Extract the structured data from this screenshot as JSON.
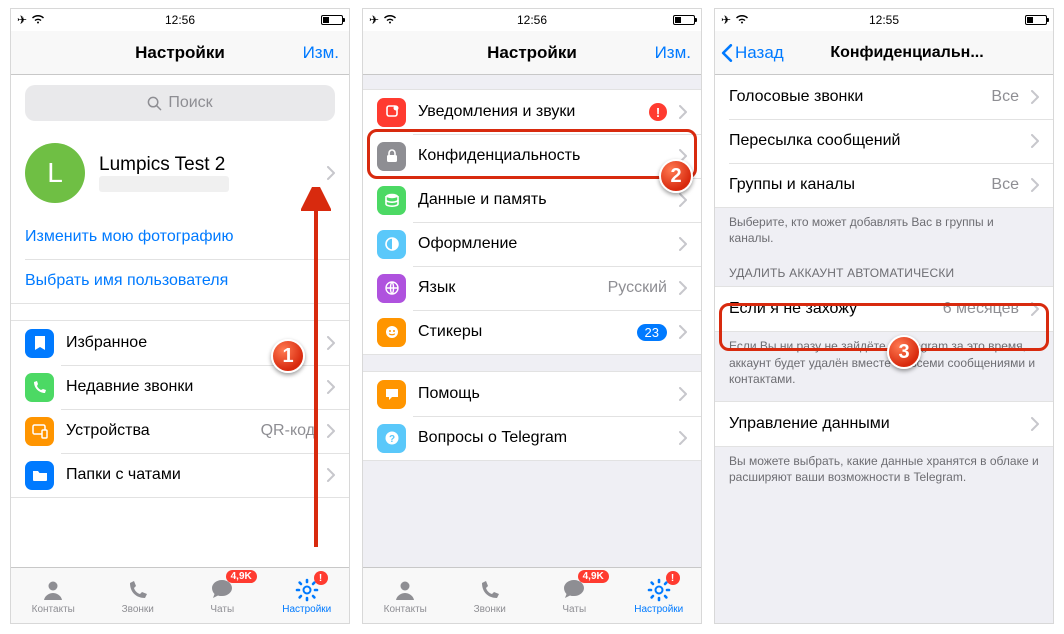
{
  "status": {
    "time1": "12:56",
    "time2": "12:56",
    "time3": "12:55"
  },
  "nav": {
    "settings_title": "Настройки",
    "edit": "Изм.",
    "back": "Назад",
    "privacy_title": "Конфиденциальн..."
  },
  "s1": {
    "search_placeholder": "Поиск",
    "profile_initial": "L",
    "profile_name": "Lumpics Test 2",
    "change_photo": "Изменить мою фотографию",
    "choose_username": "Выбрать имя пользователя",
    "favorites": "Избранное",
    "recent_calls": "Недавние звонки",
    "devices": "Устройства",
    "devices_value": "QR-код",
    "chat_folders": "Папки с чатами"
  },
  "s2": {
    "notifications": "Уведомления и звуки",
    "privacy": "Конфиденциальность",
    "data": "Данные и память",
    "appearance": "Оформление",
    "language": "Язык",
    "language_value": "Русский",
    "stickers": "Стикеры",
    "stickers_badge": "23",
    "help": "Помощь",
    "faq": "Вопросы о Telegram"
  },
  "s3": {
    "voice_calls": "Голосовые звонки",
    "voice_calls_value": "Все",
    "forwarding": "Пересылка сообщений",
    "groups": "Группы и каналы",
    "groups_value": "Все",
    "groups_footer": "Выберите, кто может добавлять Вас в группы и каналы.",
    "delete_header": "УДАЛИТЬ АККАУНТ АВТОМАТИЧЕСКИ",
    "if_away": "Если я не захожу",
    "if_away_value": "6 месяцев",
    "delete_footer": "Если Вы ни разу не зайдёте в Telegram за это время, аккаунт будет удалён вместе со всеми сообщениями и контактами.",
    "data_mgmt": "Управление данными",
    "data_footer": "Вы можете выбрать, какие данные хранятся в облаке и расширяют ваши возможности в Telegram."
  },
  "tabs": {
    "contacts": "Контакты",
    "calls": "Звонки",
    "chats": "Чаты",
    "settings": "Настройки",
    "chats_badge": "4,9K"
  },
  "annot": {
    "n1": "1",
    "n2": "2",
    "n3": "3"
  }
}
